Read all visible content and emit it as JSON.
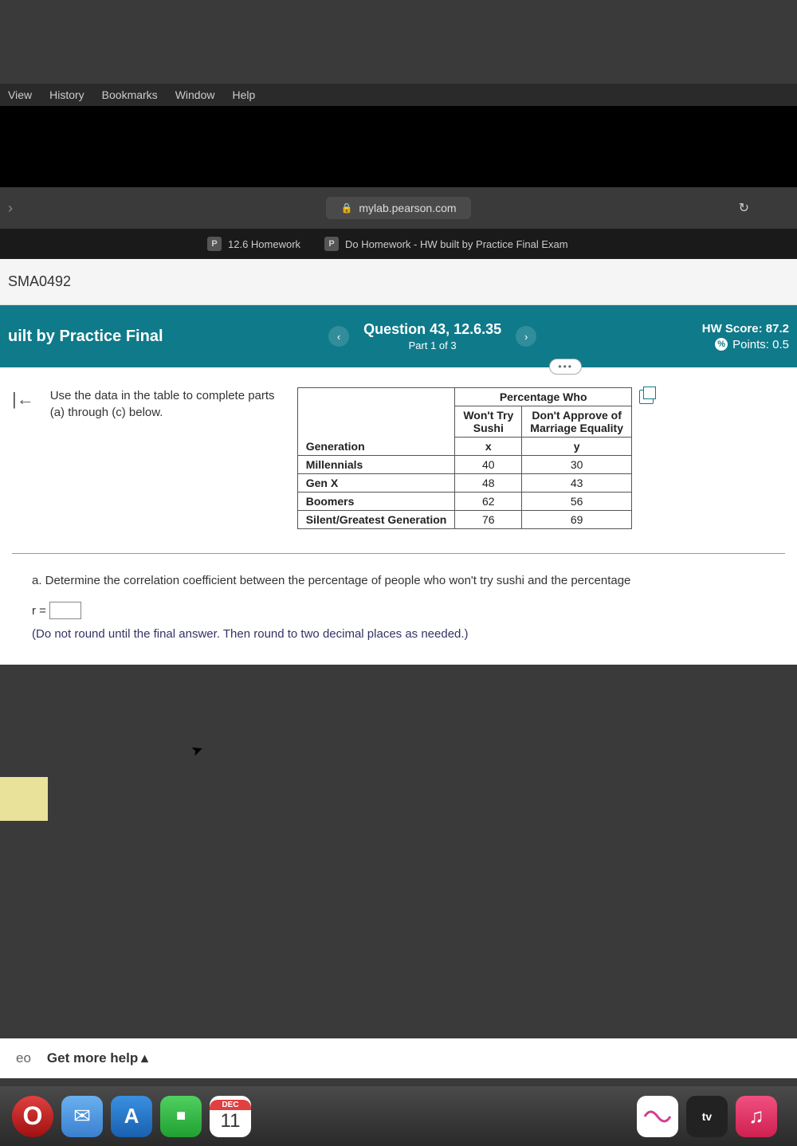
{
  "menu": {
    "items": [
      "View",
      "History",
      "Bookmarks",
      "Window",
      "Help"
    ]
  },
  "url": "mylab.pearson.com",
  "tabs": [
    {
      "label": "12.6 Homework"
    },
    {
      "label": "Do Homework - HW built by Practice Final Exam"
    }
  ],
  "course_code": "SMA0492",
  "header": {
    "hw_title": "uilt by Practice Final",
    "question_title": "Question 43, 12.6.35",
    "part_label": "Part 1 of 3",
    "score_label": "HW Score: 87.2",
    "points_label": "Points: 0.5"
  },
  "prompt": "Use the data in the table to complete parts (a) through (c) below.",
  "table": {
    "super_header": "Percentage Who",
    "col1_header_1": "Won't Try",
    "col1_header_2": "Sushi",
    "col2_header_1": "Don't Approve of",
    "col2_header_2": "Marriage Equality",
    "gen_header": "Generation",
    "x_label": "x",
    "y_label": "y",
    "rows": [
      {
        "gen": "Millennials",
        "x": "40",
        "y": "30"
      },
      {
        "gen": "Gen X",
        "x": "48",
        "y": "43"
      },
      {
        "gen": "Boomers",
        "x": "62",
        "y": "56"
      },
      {
        "gen": "Silent/Greatest Generation",
        "x": "76",
        "y": "69"
      }
    ]
  },
  "part_a": "a. Determine the correlation coefficient between the percentage of people who won't try sushi and the percentage",
  "r_label": "r =",
  "hint": "(Do not round until the final answer. Then round to two decimal places as needed.)",
  "bottom": {
    "eo": "eo",
    "help": "Get more help"
  },
  "calendar": {
    "month": "DEC",
    "day": "11"
  },
  "appletv_label": "tv",
  "chart_data": {
    "type": "table",
    "title": "Percentage Who",
    "columns": [
      "Generation",
      "Won't Try Sushi (x)",
      "Don't Approve of Marriage Equality (y)"
    ],
    "rows": [
      [
        "Millennials",
        40,
        30
      ],
      [
        "Gen X",
        48,
        43
      ],
      [
        "Boomers",
        62,
        56
      ],
      [
        "Silent/Greatest Generation",
        76,
        69
      ]
    ]
  }
}
